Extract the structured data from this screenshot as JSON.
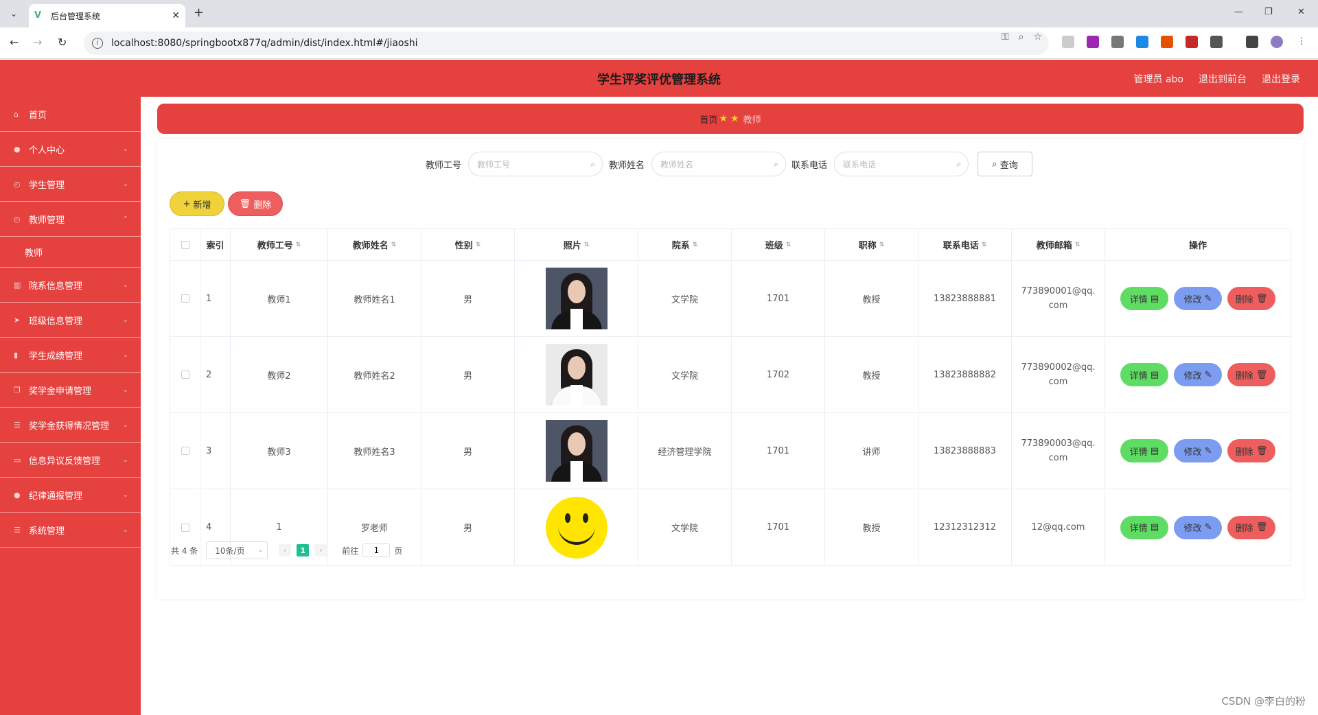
{
  "browser": {
    "tab_title": "后台管理系统",
    "url": "localhost:8080/springbootx877q/admin/dist/index.html#/jiaoshi"
  },
  "header": {
    "title": "学生评奖评优管理系统",
    "user": "管理员 abo",
    "front": "退出到前台",
    "logout": "退出登录"
  },
  "sidebar": {
    "items": [
      {
        "label": "首页",
        "icon": "home-icon"
      },
      {
        "label": "个人中心",
        "icon": "user-icon"
      },
      {
        "label": "学生管理",
        "icon": "clock-icon"
      },
      {
        "label": "教师管理",
        "icon": "clock-icon",
        "expanded": true,
        "sub": [
          "教师"
        ]
      },
      {
        "label": "院系信息管理",
        "icon": "bank-icon"
      },
      {
        "label": "班级信息管理",
        "icon": "send-icon"
      },
      {
        "label": "学生成绩管理",
        "icon": "chart-icon"
      },
      {
        "label": "奖学金申请管理",
        "icon": "copy-icon"
      },
      {
        "label": "奖学金获得情况管理",
        "icon": "list-icon"
      },
      {
        "label": "信息异议反馈管理",
        "icon": "message-icon"
      },
      {
        "label": "纪律通报管理",
        "icon": "user-icon"
      },
      {
        "label": "系统管理",
        "icon": "settings-icon"
      }
    ]
  },
  "breadcrumb": {
    "home": "首页",
    "current": "教师"
  },
  "search": {
    "f1_label": "教师工号",
    "f1_placeholder": "教师工号",
    "f2_label": "教师姓名",
    "f2_placeholder": "教师姓名",
    "f3_label": "联系电话",
    "f3_placeholder": "联系电话",
    "query": "查询"
  },
  "actions": {
    "add": "新增",
    "delete": "删除"
  },
  "table": {
    "headers": [
      "索引",
      "教师工号",
      "教师姓名",
      "性别",
      "照片",
      "院系",
      "班级",
      "职称",
      "联系电话",
      "教师邮箱",
      "操作"
    ],
    "rows": [
      {
        "idx": "1",
        "no": "教师1",
        "name": "教师姓名1",
        "sex": "男",
        "photo": "woman-dark",
        "dept": "文学院",
        "cls": "1701",
        "title": "教授",
        "phone": "13823888881",
        "email": "773890001@qq.com"
      },
      {
        "idx": "2",
        "no": "教师2",
        "name": "教师姓名2",
        "sex": "男",
        "photo": "woman-light",
        "dept": "文学院",
        "cls": "1702",
        "title": "教授",
        "phone": "13823888882",
        "email": "773890002@qq.com"
      },
      {
        "idx": "3",
        "no": "教师3",
        "name": "教师姓名3",
        "sex": "男",
        "photo": "woman-dark",
        "dept": "经济管理学院",
        "cls": "1701",
        "title": "讲师",
        "phone": "13823888883",
        "email": "773890003@qq.com"
      },
      {
        "idx": "4",
        "no": "1",
        "name": "罗老师",
        "sex": "男",
        "photo": "smiley",
        "dept": "文学院",
        "cls": "1701",
        "title": "教授",
        "phone": "12312312312",
        "email": "12@qq.com"
      }
    ],
    "op_detail": "详情",
    "op_edit": "修改",
    "op_delete": "删除"
  },
  "pager": {
    "total": "共 4 条",
    "size": "10条/页",
    "page": "1",
    "goto_prefix": "前往",
    "goto_value": "1",
    "goto_suffix": "页"
  },
  "watermark": "CSDN @李白的粉"
}
